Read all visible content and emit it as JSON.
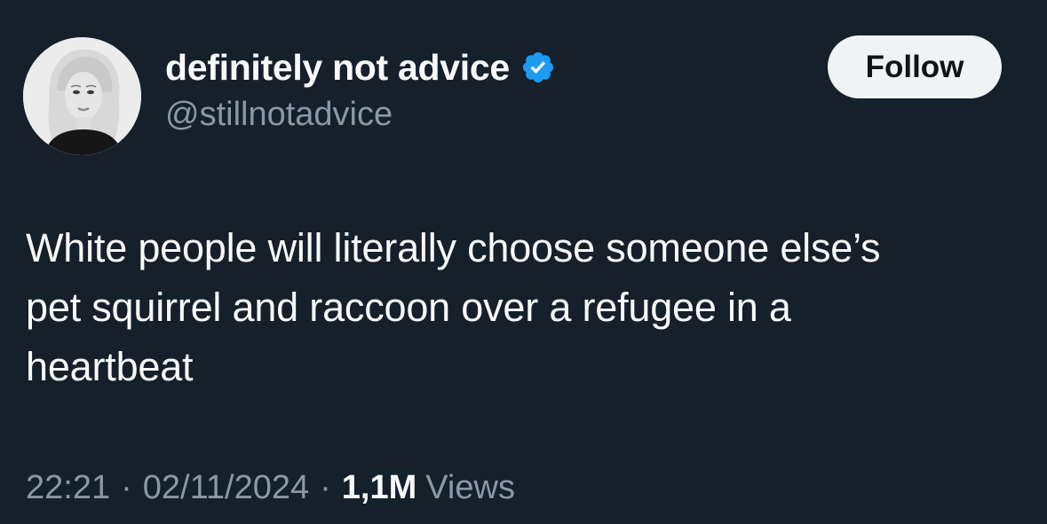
{
  "author": {
    "display_name": "definitely not advice",
    "handle": "@stillnotadvice",
    "verified": true,
    "avatar_icon": "profile-photo"
  },
  "follow_button": {
    "label": "Follow"
  },
  "tweet": {
    "text_lines": [
      "White people will literally choose someone else’s",
      "pet squirrel and raccoon over a refugee in a",
      "heartbeat"
    ]
  },
  "meta": {
    "time": "22:21",
    "separator": "·",
    "date": "02/11/2024",
    "views_count": "1,1M",
    "views_label": "Views"
  },
  "colors": {
    "background": "#15202b",
    "primary_text": "#f7f9f9",
    "secondary_text": "#8b98a5",
    "verified_badge": "#1d9bf0",
    "follow_button_bg": "#eff3f4"
  }
}
